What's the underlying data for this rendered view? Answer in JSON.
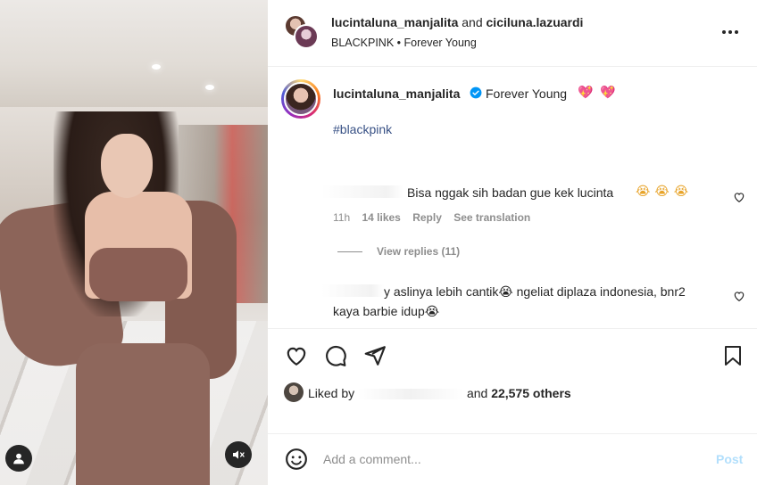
{
  "post": {
    "header": {
      "author_primary": "lucintaluna_manjalita",
      "connector": "and",
      "author_secondary": "ciciluna.lazuardi",
      "audio": "BLACKPINK • Forever Young"
    },
    "caption": {
      "username": "lucintaluna_manjalita",
      "text": "Forever Young",
      "hearts": "💖 💖",
      "hashtag": "#blackpink",
      "verified_color": "#0095f6"
    },
    "comments": [
      {
        "text": "Bisa nggak sih badan gue kek lucinta",
        "emoji": "😭😭😭",
        "time": "11h",
        "likes": "14 likes",
        "reply": "Reply",
        "translate": "See translation",
        "view_replies": "View replies (11)"
      },
      {
        "text_line1": "y aslinya lebih cantik😭 ngeliat diplaza indonesia, bnr2",
        "text_line2": "kaya barbie idup😭"
      }
    ],
    "likes": {
      "prefix": "Liked by",
      "connector": "and",
      "count_text": "22,575 others"
    },
    "comment_box": {
      "placeholder": "Add a comment...",
      "post_label": "Post"
    },
    "icons": {
      "more": "more-horizontal-icon",
      "like": "heart-icon",
      "comment": "comment-icon",
      "share": "paper-plane-icon",
      "save": "bookmark-icon",
      "emoji": "smiley-icon",
      "user_tag": "user-icon",
      "mute": "muted-speaker-icon"
    }
  }
}
